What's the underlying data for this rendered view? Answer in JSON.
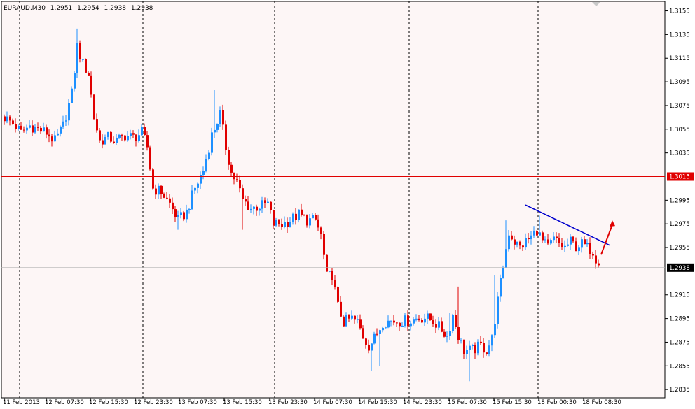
{
  "header": {
    "symbol": "EURAUD,M30",
    "open": "1.2951",
    "high": "1.2954",
    "low": "1.2938",
    "close": "1.2938"
  },
  "colors": {
    "background": "#fdf6f6",
    "bull": "#1e90ff",
    "bear": "#e00000",
    "level_line": "#e00000",
    "price_line": "#b4b4b4",
    "trend_line": "#0000cd",
    "arrow": "#e00000",
    "grid": "#000000"
  },
  "chart_data": {
    "type": "candlestick",
    "symbol": "EURAUD",
    "timeframe": "M30",
    "ylim": [
      1.2828,
      1.3163
    ],
    "y_ticks": [
      "1.3155",
      "1.3135",
      "1.3115",
      "1.3095",
      "1.3075",
      "1.3055",
      "1.3035",
      "1.2995",
      "1.2975",
      "1.2955",
      "1.2915",
      "1.2895",
      "1.2875",
      "1.2855",
      "1.2835"
    ],
    "x_ticks": [
      "11 Feb 2013",
      "12 Feb 07:30",
      "12 Feb 15:30",
      "12 Feb 23:30",
      "13 Feb 07:30",
      "13 Feb 15:30",
      "13 Feb 23:30",
      "14 Feb 07:30",
      "14 Feb 15:30",
      "14 Feb 23:30",
      "15 Feb 07:30",
      "15 Feb 15:30",
      "18 Feb 00:30",
      "18 Feb 08:30"
    ],
    "day_separators": [
      6,
      50,
      97,
      145,
      191
    ],
    "horizontal_level": {
      "value": "1.3015",
      "price": 1.3015
    },
    "current_price": {
      "value": "1.2938",
      "price": 1.2938
    },
    "trendline": {
      "from": [
        186,
        1.2991
      ],
      "to": [
        216,
        1.2957
      ]
    },
    "arrow": {
      "from": [
        213,
        1.2949
      ],
      "to": [
        217,
        1.2978
      ]
    },
    "anchors": [
      [
        0,
        1.3065
      ],
      [
        3,
        1.306
      ],
      [
        6,
        1.3052
      ],
      [
        9,
        1.3058
      ],
      [
        12,
        1.3055
      ],
      [
        15,
        1.3052
      ],
      [
        18,
        1.3045
      ],
      [
        21,
        1.3058
      ],
      [
        24,
        1.3085
      ],
      [
        26,
        1.3125
      ],
      [
        28,
        1.311
      ],
      [
        30,
        1.3102
      ],
      [
        32,
        1.3065
      ],
      [
        34,
        1.3045
      ],
      [
        37,
        1.3048
      ],
      [
        40,
        1.3045
      ],
      [
        43,
        1.305
      ],
      [
        46,
        1.3048
      ],
      [
        49,
        1.3052
      ],
      [
        51,
        1.304
      ],
      [
        53,
        1.3005
      ],
      [
        56,
        1.3002
      ],
      [
        59,
        1.2992
      ],
      [
        62,
        1.2978
      ],
      [
        65,
        1.2985
      ],
      [
        68,
        1.3005
      ],
      [
        71,
        1.302
      ],
      [
        74,
        1.305
      ],
      [
        77,
        1.3068
      ],
      [
        79,
        1.304
      ],
      [
        81,
        1.3018
      ],
      [
        83,
        1.301
      ],
      [
        85,
        1.2995
      ],
      [
        88,
        1.2988
      ],
      [
        91,
        1.299
      ],
      [
        94,
        1.2992
      ],
      [
        96,
        1.2975
      ],
      [
        99,
        1.2975
      ],
      [
        102,
        1.2978
      ],
      [
        105,
        1.2983
      ],
      [
        108,
        1.2978
      ],
      [
        111,
        1.2978
      ],
      [
        113,
        1.2965
      ],
      [
        115,
        1.293
      ],
      [
        117,
        1.2932
      ],
      [
        119,
        1.2905
      ],
      [
        121,
        1.2892
      ],
      [
        124,
        1.2895
      ],
      [
        126,
        1.2892
      ],
      [
        128,
        1.288
      ],
      [
        130,
        1.2872
      ],
      [
        132,
        1.2878
      ],
      [
        135,
        1.2892
      ],
      [
        138,
        1.2893
      ],
      [
        141,
        1.2893
      ],
      [
        144,
        1.2893
      ],
      [
        147,
        1.2895
      ],
      [
        150,
        1.2896
      ],
      [
        153,
        1.2893
      ],
      [
        155,
        1.2888
      ],
      [
        158,
        1.288
      ],
      [
        160,
        1.2898
      ],
      [
        162,
        1.288
      ],
      [
        164,
        1.2868
      ],
      [
        167,
        1.2868
      ],
      [
        170,
        1.2872
      ],
      [
        172,
        1.2868
      ],
      [
        174,
        1.2878
      ],
      [
        176,
        1.291
      ],
      [
        178,
        1.294
      ],
      [
        180,
        1.2968
      ],
      [
        182,
        1.296
      ],
      [
        184,
        1.2955
      ],
      [
        186,
        1.296
      ],
      [
        188,
        1.2964
      ],
      [
        190,
        1.297
      ],
      [
        192,
        1.296
      ],
      [
        194,
        1.2955
      ],
      [
        196,
        1.2962
      ],
      [
        198,
        1.2958
      ],
      [
        200,
        1.2955
      ],
      [
        202,
        1.296
      ],
      [
        204,
        1.2956
      ],
      [
        206,
        1.2958
      ],
      [
        208,
        1.2955
      ],
      [
        210,
        1.2952
      ],
      [
        212,
        1.294
      ]
    ],
    "spikes": [
      [
        26,
        1.314,
        "h"
      ],
      [
        27,
        1.313,
        "h"
      ],
      [
        75,
        1.3088,
        "h"
      ],
      [
        62,
        1.297,
        "l"
      ],
      [
        85,
        1.297,
        "l"
      ],
      [
        131,
        1.2851,
        "l"
      ],
      [
        134,
        1.2855,
        "l"
      ],
      [
        166,
        1.2842,
        "l"
      ],
      [
        159,
        1.29,
        "h"
      ],
      [
        162,
        1.2922,
        "h"
      ],
      [
        175,
        1.2932,
        "h"
      ],
      [
        179,
        1.2978,
        "h"
      ],
      [
        191,
        1.2982,
        "h"
      ],
      [
        211,
        1.2937,
        "l"
      ]
    ]
  }
}
